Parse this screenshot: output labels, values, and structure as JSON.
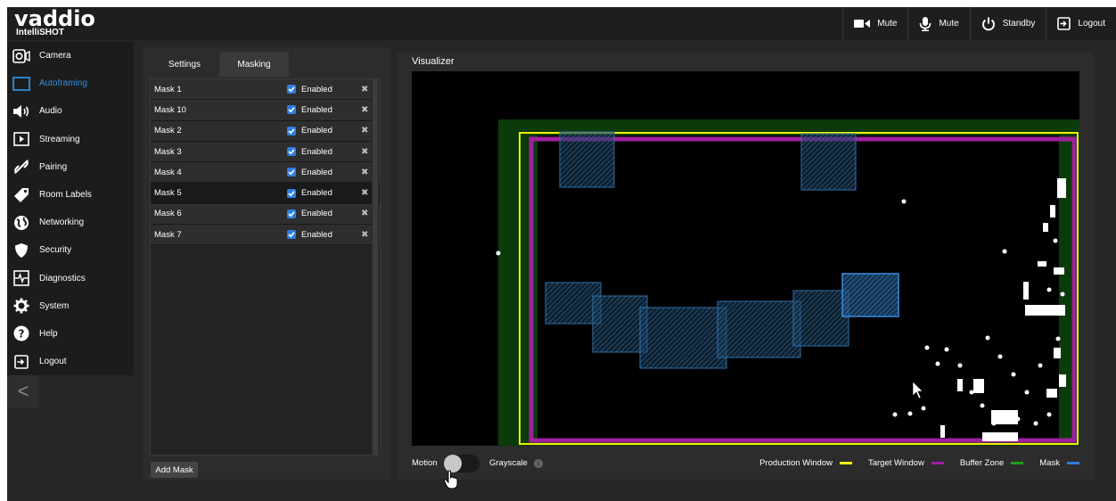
{
  "header": {
    "brand": "vaddio",
    "product": "IntelliSHOT",
    "buttons": [
      {
        "label": "Mute",
        "icon": "video-camera-icon"
      },
      {
        "label": "Mute",
        "icon": "microphone-icon"
      },
      {
        "label": "Standby",
        "icon": "power-icon"
      },
      {
        "label": "Logout",
        "icon": "logout-icon"
      }
    ]
  },
  "sidebar": {
    "items": [
      {
        "label": "Camera",
        "icon": "camera-icon"
      },
      {
        "label": "Autoframing",
        "icon": "autoframing-icon",
        "active": true
      },
      {
        "label": "Audio",
        "icon": "speaker-icon"
      },
      {
        "label": "Streaming",
        "icon": "play-icon"
      },
      {
        "label": "Pairing",
        "icon": "link-icon"
      },
      {
        "label": "Room Labels",
        "icon": "tag-icon"
      },
      {
        "label": "Networking",
        "icon": "globe-icon"
      },
      {
        "label": "Security",
        "icon": "shield-icon"
      },
      {
        "label": "Diagnostics",
        "icon": "pulse-icon"
      },
      {
        "label": "System",
        "icon": "gear-icon"
      },
      {
        "label": "Help",
        "icon": "help-icon"
      },
      {
        "label": "Logout",
        "icon": "logout-icon"
      }
    ],
    "collapse_glyph": "<"
  },
  "settings": {
    "tabs": [
      {
        "label": "Settings",
        "active": false
      },
      {
        "label": "Masking",
        "active": true
      }
    ],
    "masks": [
      {
        "name": "Mask 1",
        "enabled_label": "Enabled",
        "enabled": true
      },
      {
        "name": "Mask 10",
        "enabled_label": "Enabled",
        "enabled": true
      },
      {
        "name": "Mask 2",
        "enabled_label": "Enabled",
        "enabled": true
      },
      {
        "name": "Mask 3",
        "enabled_label": "Enabled",
        "enabled": true
      },
      {
        "name": "Mask 4",
        "enabled_label": "Enabled",
        "enabled": true
      },
      {
        "name": "Mask 5",
        "enabled_label": "Enabled",
        "enabled": true,
        "selected": true
      },
      {
        "name": "Mask 6",
        "enabled_label": "Enabled",
        "enabled": true
      },
      {
        "name": "Mask 7",
        "enabled_label": "Enabled",
        "enabled": true
      }
    ],
    "add_mask_label": "Add Mask"
  },
  "visualizer": {
    "title": "Visualizer",
    "motion_label": "Motion",
    "motion_enabled": false,
    "grayscale_label": "Grayscale",
    "info_glyph": "i",
    "legend": [
      {
        "label": "Production Window",
        "color": "#f0f000"
      },
      {
        "label": "Target Window",
        "color": "#a020a0"
      },
      {
        "label": "Buffer Zone",
        "color": "#18a018"
      },
      {
        "label": "Mask",
        "color": "#2f7de0"
      }
    ]
  },
  "colors": {
    "accent": "#2f8fe0",
    "production_window": "#f0f000",
    "target_window": "#a020a0",
    "buffer_zone": "#0a3d0a",
    "mask_stroke": "#2f7de0"
  }
}
